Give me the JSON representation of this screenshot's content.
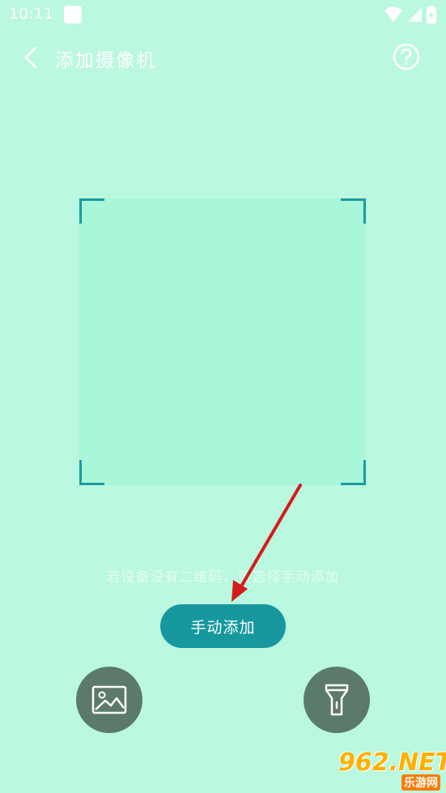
{
  "status_bar": {
    "time": "10:11"
  },
  "header": {
    "title": "添加摄像机"
  },
  "scan": {
    "hint": "若设备没有二维码，可选择手动添加"
  },
  "actions": {
    "manual_add_label": "手动添加"
  },
  "icons": {
    "back": "back-arrow-icon",
    "help": "help-circle-icon",
    "gallery": "image-gallery-icon",
    "torch": "flashlight-icon"
  },
  "colors": {
    "background": "#baf8df",
    "scan_area": "#a7f7d8",
    "accent": "#17989e",
    "round_button": "#5b7a6c",
    "annotation_arrow": "#d41c1c"
  },
  "watermark": {
    "main": "962.NET",
    "sub": "乐游网"
  }
}
